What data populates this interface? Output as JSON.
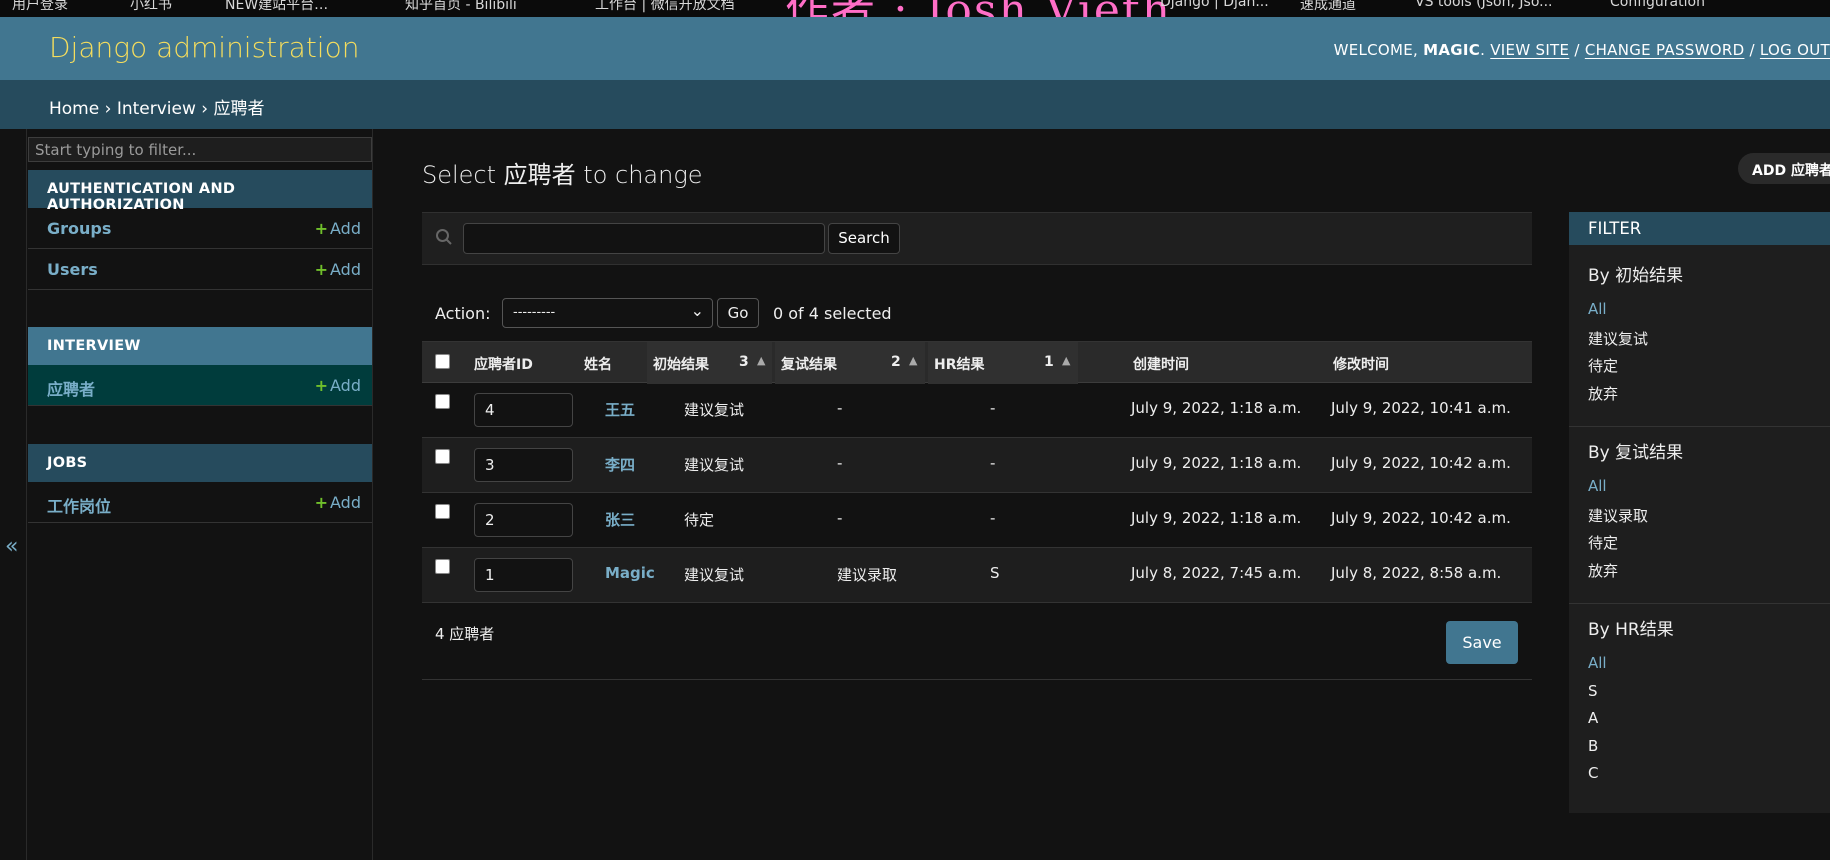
{
  "browser_tabs": [
    "用户登录",
    "小红书",
    "NEW建站平台…",
    "知乎首页 - Bilibili",
    "工作台 | 微信开放文档",
    "作者 : Josh Vieth",
    "Django | Djan...",
    "速成通道",
    "VS tools (Json, Jso...",
    "Configuration"
  ],
  "watermark": "作者 : Josh Vieth",
  "header": {
    "brand": "Django administration",
    "welcome": "WELCOME, ",
    "username": "MAGIC",
    "view_site": "VIEW SITE",
    "change_password": "CHANGE PASSWORD",
    "logout": "LOG OUT",
    "sep": " / ",
    "dot": ". "
  },
  "breadcrumbs": {
    "home": "Home",
    "app": "Interview",
    "current": "应聘者",
    "sep": " › "
  },
  "sidebar": {
    "toggle": "«",
    "filter_placeholder": "Start typing to filter...",
    "add_label": "Add",
    "auth": {
      "title": "AUTHENTICATION AND AUTHORIZATION",
      "items": [
        "Groups",
        "Users"
      ]
    },
    "interview": {
      "title": "INTERVIEW",
      "items": [
        "应聘者"
      ]
    },
    "jobs": {
      "title": "JOBS",
      "items": [
        "工作岗位"
      ]
    }
  },
  "main": {
    "title": "Select 应聘者 to change",
    "add_button": "ADD 应聘者",
    "search_button": "Search",
    "action_label": "Action:",
    "action_selected": "---------",
    "go_button": "Go",
    "selected_count": "0 of 4 selected",
    "columns": [
      "应聘者ID",
      "姓名",
      "初始结果",
      "复试结果",
      "HR结果",
      "创建时间",
      "修改时间"
    ],
    "sort_numbers": [
      "3",
      "2",
      "1"
    ],
    "rows": [
      {
        "id": "4",
        "name": "王五",
        "first": "建议复试",
        "second": "-",
        "hr": "-",
        "created": "July 9, 2022, 1:18 a.m.",
        "modified": "July 9, 2022, 10:41 a.m."
      },
      {
        "id": "3",
        "name": "李四",
        "first": "建议复试",
        "second": "-",
        "hr": "-",
        "created": "July 9, 2022, 1:18 a.m.",
        "modified": "July 9, 2022, 10:42 a.m."
      },
      {
        "id": "2",
        "name": "张三",
        "first": "待定",
        "second": "-",
        "hr": "-",
        "created": "July 9, 2022, 1:18 a.m.",
        "modified": "July 9, 2022, 10:42 a.m."
      },
      {
        "id": "1",
        "name": "Magic",
        "first": "建议复试",
        "second": "建议录取",
        "hr": "S",
        "created": "July 8, 2022, 7:45 a.m.",
        "modified": "July 8, 2022, 8:58 a.m."
      }
    ],
    "result_count": "4 应聘者",
    "save_button": "Save"
  },
  "filter": {
    "title": "FILTER",
    "groups": [
      {
        "title": "By 初始结果",
        "items": [
          "All",
          "建议复试",
          "待定",
          "放弃"
        ]
      },
      {
        "title": "By 复试结果",
        "items": [
          "All",
          "建议录取",
          "待定",
          "放弃"
        ]
      },
      {
        "title": "By HR结果",
        "items": [
          "All",
          "S",
          "A",
          "B",
          "C"
        ]
      }
    ]
  },
  "colors": {
    "header": "#417690",
    "breadcrumbs": "#264b5d",
    "brand": "#f5dd5d",
    "link": "#79aec8",
    "add_plus": "#70bf2b",
    "active_row": "#003c3c"
  },
  "icons": [
    "search-icon",
    "plus-icon",
    "chevron-down-icon",
    "sort-asc-icon",
    "collapse-icon"
  ]
}
